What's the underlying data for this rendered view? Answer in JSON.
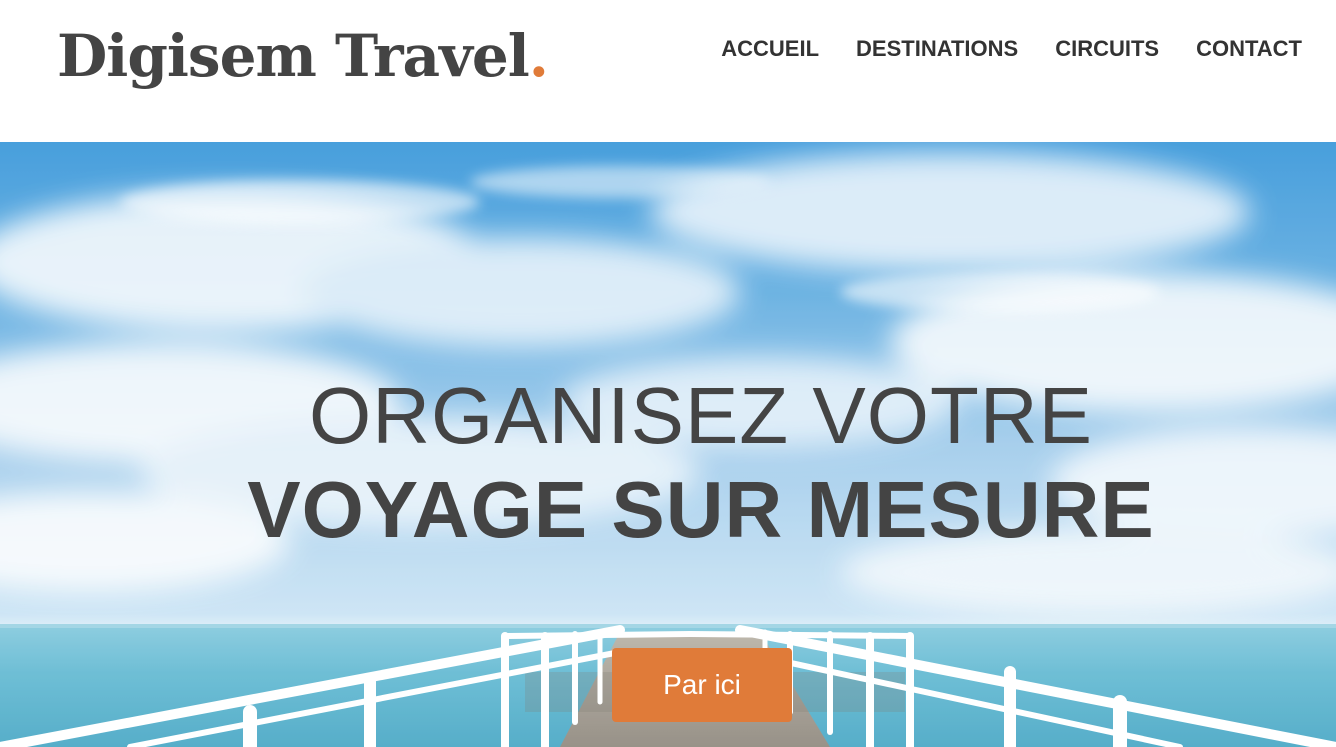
{
  "brand": {
    "name": "Digisem Travel",
    "dot": ".",
    "accent_color": "#e07b39"
  },
  "nav": {
    "items": [
      {
        "label": "ACCUEIL"
      },
      {
        "label": "DESTINATIONS"
      },
      {
        "label": "CIRCUITS"
      },
      {
        "label": "CONTACT"
      }
    ]
  },
  "hero": {
    "line1": "ORGANISEZ VOTRE",
    "line2": "VOYAGE SUR MESURE",
    "cta_label": "Par ici",
    "background": "sky-sea-pier-image"
  }
}
